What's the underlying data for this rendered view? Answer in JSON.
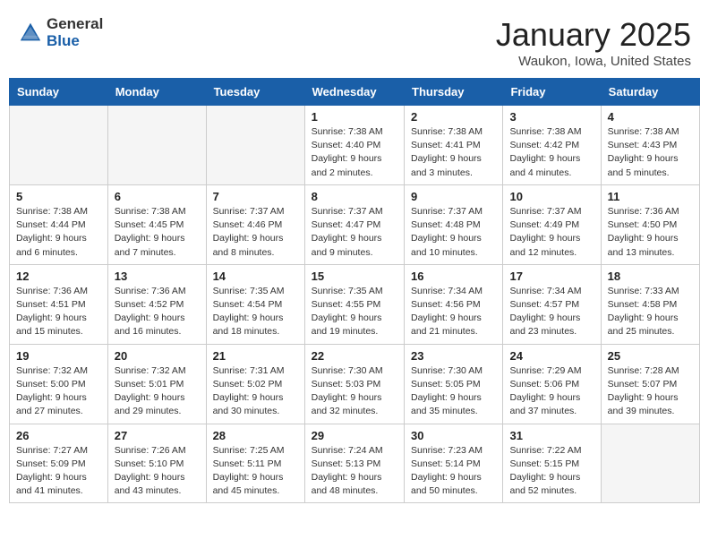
{
  "header": {
    "logo_general": "General",
    "logo_blue": "Blue",
    "month_title": "January 2025",
    "location": "Waukon, Iowa, United States"
  },
  "days_of_week": [
    "Sunday",
    "Monday",
    "Tuesday",
    "Wednesday",
    "Thursday",
    "Friday",
    "Saturday"
  ],
  "weeks": [
    [
      {
        "day": "",
        "empty": true
      },
      {
        "day": "",
        "empty": true
      },
      {
        "day": "",
        "empty": true
      },
      {
        "day": "1",
        "sunrise": "7:38 AM",
        "sunset": "4:40 PM",
        "daylight": "9 hours and 2 minutes."
      },
      {
        "day": "2",
        "sunrise": "7:38 AM",
        "sunset": "4:41 PM",
        "daylight": "9 hours and 3 minutes."
      },
      {
        "day": "3",
        "sunrise": "7:38 AM",
        "sunset": "4:42 PM",
        "daylight": "9 hours and 4 minutes."
      },
      {
        "day": "4",
        "sunrise": "7:38 AM",
        "sunset": "4:43 PM",
        "daylight": "9 hours and 5 minutes."
      }
    ],
    [
      {
        "day": "5",
        "sunrise": "7:38 AM",
        "sunset": "4:44 PM",
        "daylight": "9 hours and 6 minutes."
      },
      {
        "day": "6",
        "sunrise": "7:38 AM",
        "sunset": "4:45 PM",
        "daylight": "9 hours and 7 minutes."
      },
      {
        "day": "7",
        "sunrise": "7:37 AM",
        "sunset": "4:46 PM",
        "daylight": "9 hours and 8 minutes."
      },
      {
        "day": "8",
        "sunrise": "7:37 AM",
        "sunset": "4:47 PM",
        "daylight": "9 hours and 9 minutes."
      },
      {
        "day": "9",
        "sunrise": "7:37 AM",
        "sunset": "4:48 PM",
        "daylight": "9 hours and 10 minutes."
      },
      {
        "day": "10",
        "sunrise": "7:37 AM",
        "sunset": "4:49 PM",
        "daylight": "9 hours and 12 minutes."
      },
      {
        "day": "11",
        "sunrise": "7:36 AM",
        "sunset": "4:50 PM",
        "daylight": "9 hours and 13 minutes."
      }
    ],
    [
      {
        "day": "12",
        "sunrise": "7:36 AM",
        "sunset": "4:51 PM",
        "daylight": "9 hours and 15 minutes."
      },
      {
        "day": "13",
        "sunrise": "7:36 AM",
        "sunset": "4:52 PM",
        "daylight": "9 hours and 16 minutes."
      },
      {
        "day": "14",
        "sunrise": "7:35 AM",
        "sunset": "4:54 PM",
        "daylight": "9 hours and 18 minutes."
      },
      {
        "day": "15",
        "sunrise": "7:35 AM",
        "sunset": "4:55 PM",
        "daylight": "9 hours and 19 minutes."
      },
      {
        "day": "16",
        "sunrise": "7:34 AM",
        "sunset": "4:56 PM",
        "daylight": "9 hours and 21 minutes."
      },
      {
        "day": "17",
        "sunrise": "7:34 AM",
        "sunset": "4:57 PM",
        "daylight": "9 hours and 23 minutes."
      },
      {
        "day": "18",
        "sunrise": "7:33 AM",
        "sunset": "4:58 PM",
        "daylight": "9 hours and 25 minutes."
      }
    ],
    [
      {
        "day": "19",
        "sunrise": "7:32 AM",
        "sunset": "5:00 PM",
        "daylight": "9 hours and 27 minutes."
      },
      {
        "day": "20",
        "sunrise": "7:32 AM",
        "sunset": "5:01 PM",
        "daylight": "9 hours and 29 minutes."
      },
      {
        "day": "21",
        "sunrise": "7:31 AM",
        "sunset": "5:02 PM",
        "daylight": "9 hours and 30 minutes."
      },
      {
        "day": "22",
        "sunrise": "7:30 AM",
        "sunset": "5:03 PM",
        "daylight": "9 hours and 32 minutes."
      },
      {
        "day": "23",
        "sunrise": "7:30 AM",
        "sunset": "5:05 PM",
        "daylight": "9 hours and 35 minutes."
      },
      {
        "day": "24",
        "sunrise": "7:29 AM",
        "sunset": "5:06 PM",
        "daylight": "9 hours and 37 minutes."
      },
      {
        "day": "25",
        "sunrise": "7:28 AM",
        "sunset": "5:07 PM",
        "daylight": "9 hours and 39 minutes."
      }
    ],
    [
      {
        "day": "26",
        "sunrise": "7:27 AM",
        "sunset": "5:09 PM",
        "daylight": "9 hours and 41 minutes."
      },
      {
        "day": "27",
        "sunrise": "7:26 AM",
        "sunset": "5:10 PM",
        "daylight": "9 hours and 43 minutes."
      },
      {
        "day": "28",
        "sunrise": "7:25 AM",
        "sunset": "5:11 PM",
        "daylight": "9 hours and 45 minutes."
      },
      {
        "day": "29",
        "sunrise": "7:24 AM",
        "sunset": "5:13 PM",
        "daylight": "9 hours and 48 minutes."
      },
      {
        "day": "30",
        "sunrise": "7:23 AM",
        "sunset": "5:14 PM",
        "daylight": "9 hours and 50 minutes."
      },
      {
        "day": "31",
        "sunrise": "7:22 AM",
        "sunset": "5:15 PM",
        "daylight": "9 hours and 52 minutes."
      },
      {
        "day": "",
        "empty": true
      }
    ]
  ],
  "labels": {
    "sunrise_prefix": "Sunrise: ",
    "sunset_prefix": "Sunset: ",
    "daylight_prefix": "Daylight: "
  }
}
